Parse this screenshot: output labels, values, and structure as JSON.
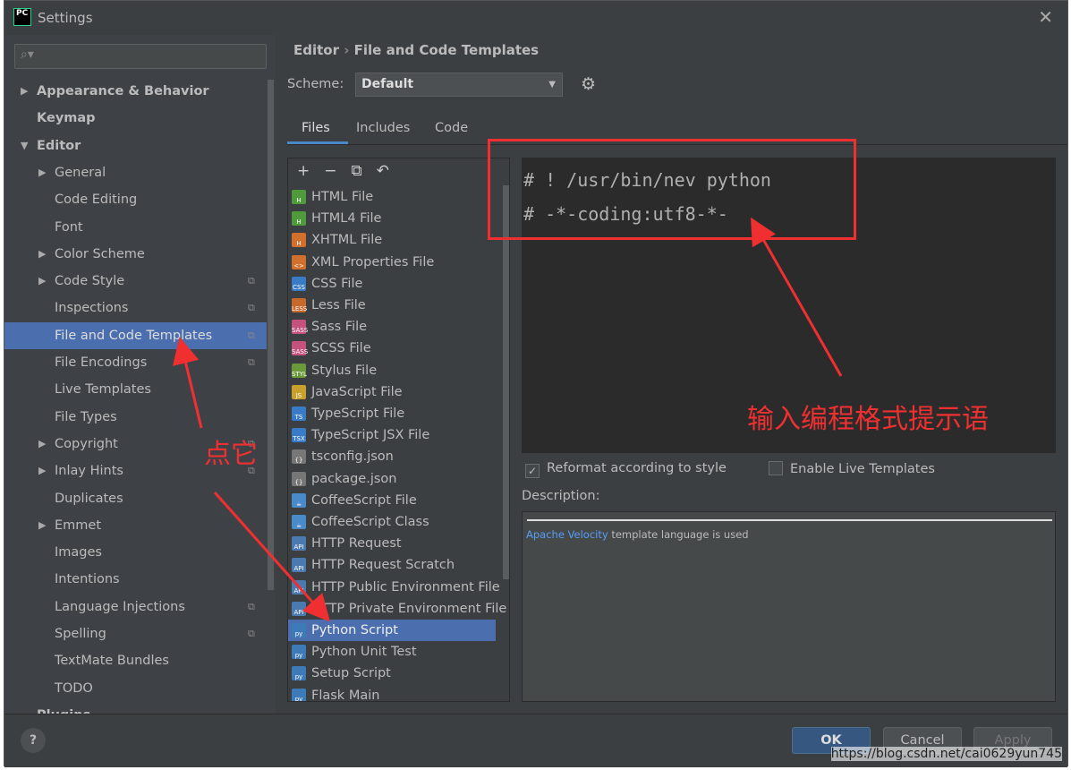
{
  "window": {
    "title": "Settings",
    "logo": "PC",
    "close": "✕"
  },
  "search": {
    "placeholder": "",
    "icon": "search-icon"
  },
  "tree": [
    {
      "label": "Appearance & Behavior",
      "level": 0,
      "arrow": "▶",
      "bold": true
    },
    {
      "label": "Keymap",
      "level": 0,
      "bold": true
    },
    {
      "label": "Editor",
      "level": 0,
      "arrow": "▼",
      "bold": true
    },
    {
      "label": "General",
      "level": 1,
      "arrow": "▶"
    },
    {
      "label": "Code Editing",
      "level": 1
    },
    {
      "label": "Font",
      "level": 1
    },
    {
      "label": "Color Scheme",
      "level": 1,
      "arrow": "▶"
    },
    {
      "label": "Code Style",
      "level": 1,
      "arrow": "▶",
      "copy": true
    },
    {
      "label": "Inspections",
      "level": 1,
      "copy": true
    },
    {
      "label": "File and Code Templates",
      "level": 1,
      "copy": true,
      "selected": true
    },
    {
      "label": "File Encodings",
      "level": 1,
      "copy": true
    },
    {
      "label": "Live Templates",
      "level": 1
    },
    {
      "label": "File Types",
      "level": 1
    },
    {
      "label": "Copyright",
      "level": 1,
      "arrow": "▶",
      "copy": true
    },
    {
      "label": "Inlay Hints",
      "level": 1,
      "arrow": "▶",
      "copy": true
    },
    {
      "label": "Duplicates",
      "level": 1
    },
    {
      "label": "Emmet",
      "level": 1,
      "arrow": "▶"
    },
    {
      "label": "Images",
      "level": 1
    },
    {
      "label": "Intentions",
      "level": 1
    },
    {
      "label": "Language Injections",
      "level": 1,
      "copy": true
    },
    {
      "label": "Spelling",
      "level": 1,
      "copy": true
    },
    {
      "label": "TextMate Bundles",
      "level": 1
    },
    {
      "label": "TODO",
      "level": 1
    },
    {
      "label": "Plugins",
      "level": 0,
      "bold": true
    }
  ],
  "breadcrumb": {
    "parent": "Editor",
    "sep": "›",
    "current": "File and Code Templates"
  },
  "scheme": {
    "label": "Scheme:",
    "value": "Default"
  },
  "tabs": [
    {
      "label": "Files",
      "active": true
    },
    {
      "label": "Includes"
    },
    {
      "label": "Code"
    }
  ],
  "list_toolbar": "+−⧉↶",
  "templates": [
    {
      "label": "HTML File",
      "icon": "H",
      "color": "#4f9a3b"
    },
    {
      "label": "HTML4 File",
      "icon": "H",
      "color": "#4f9a3b"
    },
    {
      "label": "XHTML File",
      "icon": "H",
      "color": "#d0702c"
    },
    {
      "label": "XML Properties File",
      "icon": "<>",
      "color": "#d0702c"
    },
    {
      "label": "CSS File",
      "icon": "CSS",
      "color": "#3a7bc8"
    },
    {
      "label": "Less File",
      "icon": "LESS",
      "color": "#c8692c"
    },
    {
      "label": "Sass File",
      "icon": "SASS",
      "color": "#c4527a"
    },
    {
      "label": "SCSS File",
      "icon": "SASS",
      "color": "#c4527a"
    },
    {
      "label": "Stylus File",
      "icon": "STYL",
      "color": "#6b9a3b"
    },
    {
      "label": "JavaScript File",
      "icon": "JS",
      "color": "#c8a02c"
    },
    {
      "label": "TypeScript File",
      "icon": "TS",
      "color": "#3a7bc8"
    },
    {
      "label": "TypeScript JSX File",
      "icon": "TSX",
      "color": "#3a7bc8"
    },
    {
      "label": "tsconfig.json",
      "icon": "{}",
      "color": "#777"
    },
    {
      "label": "package.json",
      "icon": "{}",
      "color": "#777"
    },
    {
      "label": "CoffeeScript File",
      "icon": "☕",
      "color": "#4a8ac8"
    },
    {
      "label": "CoffeeScript Class",
      "icon": "☕",
      "color": "#4a8ac8"
    },
    {
      "label": "HTTP Request",
      "icon": "API",
      "color": "#4a7ab0"
    },
    {
      "label": "HTTP Request Scratch",
      "icon": "API",
      "color": "#4a7ab0"
    },
    {
      "label": "HTTP Public Environment File",
      "icon": "API",
      "color": "#4a7ab0"
    },
    {
      "label": "HTTP Private Environment File",
      "icon": "API",
      "color": "#4a7ab0"
    },
    {
      "label": "Python Script",
      "icon": "py",
      "color": "#3d7ab8",
      "selected": true
    },
    {
      "label": "Python Unit Test",
      "icon": "py",
      "color": "#3d7ab8"
    },
    {
      "label": "Setup Script",
      "icon": "py",
      "color": "#3d7ab8"
    },
    {
      "label": "Flask Main",
      "icon": "py",
      "color": "#3d7ab8"
    }
  ],
  "editor": {
    "lines": [
      "# ! /usr/bin/nev python",
      "# -*-coding:utf8-*-"
    ]
  },
  "options": {
    "reformat": {
      "label": "Reformat according to style",
      "checked": true
    },
    "live": {
      "label": "Enable Live Templates",
      "checked": false
    }
  },
  "description": {
    "label": "Description:",
    "link": "Apache Velocity",
    "text": " template language is used"
  },
  "buttons": {
    "help": "?",
    "ok": "OK",
    "cancel": "Cancel",
    "apply": "Apply"
  },
  "annotations": {
    "click_it": "点它",
    "hint": "输入编程格式提示语",
    "color": "#f03030"
  },
  "watermark": "https://blog.csdn.net/cai0629yun745"
}
